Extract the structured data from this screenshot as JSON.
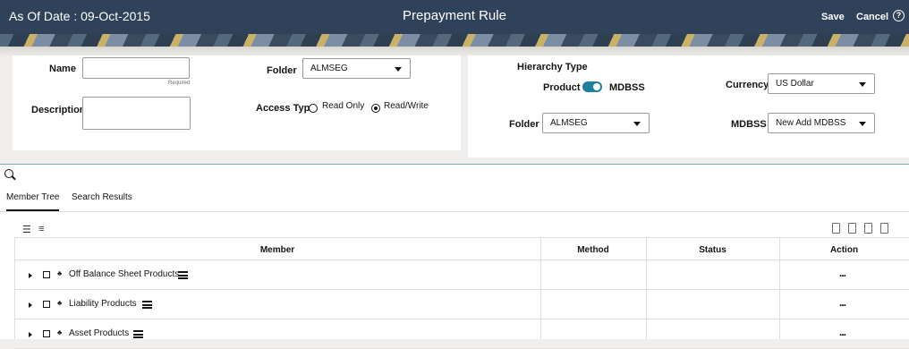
{
  "header": {
    "as_of_date": "As Of Date : 09-Oct-2015",
    "title": "Prepayment Rule",
    "save_label": "Save",
    "cancel_label": "Cancel",
    "help_icon": "help-icon"
  },
  "form": {
    "name_label": "Name",
    "name_value": "",
    "name_hint": "Required",
    "description_label": "Description",
    "description_value": "",
    "folder_label": "Folder",
    "folder_value": "ALMSEG",
    "access_type_label": "Access Type",
    "access_options": [
      "Read Only",
      "Read/Write"
    ],
    "access_selected": "Read/Write"
  },
  "hierarchy": {
    "type_label": "Hierarchy Type",
    "product_label": "Product",
    "mdbss_label": "MDBSS",
    "toggle_on": true,
    "currency_label": "Currency",
    "currency_value": "US Dollar",
    "folder_label": "Folder",
    "folder_value": "ALMSEG",
    "mdbss_field_label": "MDBSS",
    "mdbss_value": "New Add MDBSS"
  },
  "tabs": [
    "Member Tree",
    "Search Results"
  ],
  "active_tab": "Member Tree",
  "grid": {
    "columns": [
      "Member",
      "Method",
      "Status",
      "Action"
    ],
    "rows": [
      {
        "member": "Off Balance Sheet Products",
        "method": "",
        "status": "",
        "action": "..."
      },
      {
        "member": "Liability Products",
        "method": "",
        "status": "",
        "action": "..."
      },
      {
        "member": "Asset Products",
        "method": "",
        "status": "",
        "action": "..."
      }
    ]
  },
  "colors": {
    "header_bg": "#30425a",
    "toggle_accent": "#227e9e"
  }
}
